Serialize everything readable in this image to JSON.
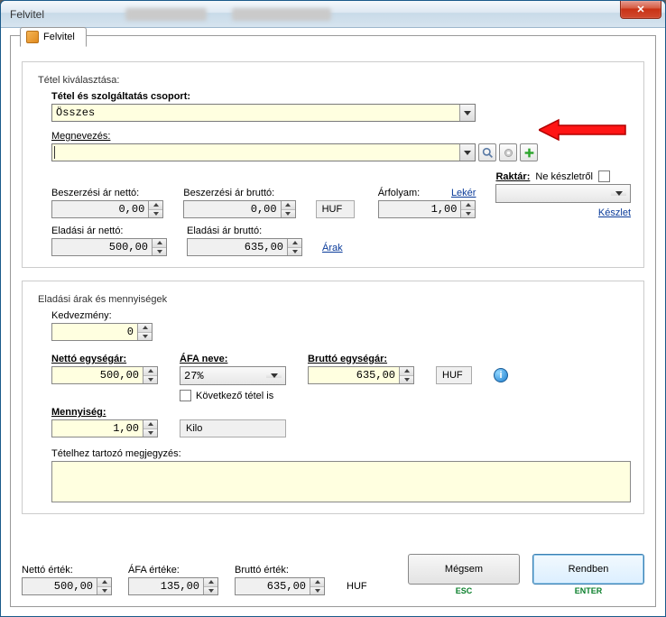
{
  "window": {
    "title": "Felvitel"
  },
  "tab": {
    "label": "Felvitel"
  },
  "group1": {
    "legend": "Tétel kiválasztása:",
    "group_label": "Tétel és szolgáltatás csoport:",
    "group_value": "Összes",
    "name_label": "Megnevezés:",
    "name_value": "",
    "buy_net_label": "Beszerzési ár nettó:",
    "buy_net_value": "0,00",
    "buy_gross_label": "Beszerzési ár bruttó:",
    "buy_gross_value": "0,00",
    "currency": "HUF",
    "rate_label": "Árfolyam:",
    "rate_btn": "Lekér",
    "rate_value": "1,00",
    "stock_label": "Raktár:",
    "stock_chk_label": "Ne készletről",
    "stock_link": "Készlet",
    "sell_net_label": "Eladási ár nettó:",
    "sell_net_value": "500,00",
    "sell_gross_label": "Eladási ár bruttó:",
    "sell_gross_value": "635,00",
    "prices_link": "Árak"
  },
  "group2": {
    "legend": "Eladási árak és mennyiségek",
    "discount_label": "Kedvezmény:",
    "discount_value": "0",
    "net_unit_label": "Nettó egységár:",
    "net_unit_value": "500,00",
    "vat_label": "ÁFA neve:",
    "vat_value": "27%",
    "next_item_label": "Következő tétel is",
    "gross_unit_label": "Bruttó egységár:",
    "gross_unit_value": "635,00",
    "unit_currency": "HUF",
    "qty_label": "Mennyiség:",
    "qty_value": "1,00",
    "unit_name": "Kilo",
    "note_label": "Tételhez tartozó megjegyzés:"
  },
  "footer": {
    "net_label": "Nettó érték:",
    "net_value": "500,00",
    "vat_label": "ÁFA értéke:",
    "vat_value": "135,00",
    "gross_label": "Bruttó érték:",
    "gross_value": "635,00",
    "currency": "HUF",
    "cancel": "Mégsem",
    "cancel_key": "ESC",
    "ok": "Rendben",
    "ok_key": "ENTER"
  },
  "icons": {
    "close": "✕",
    "search": "search-icon",
    "gear": "gear-icon",
    "plus": "plus-icon",
    "info": "i"
  }
}
